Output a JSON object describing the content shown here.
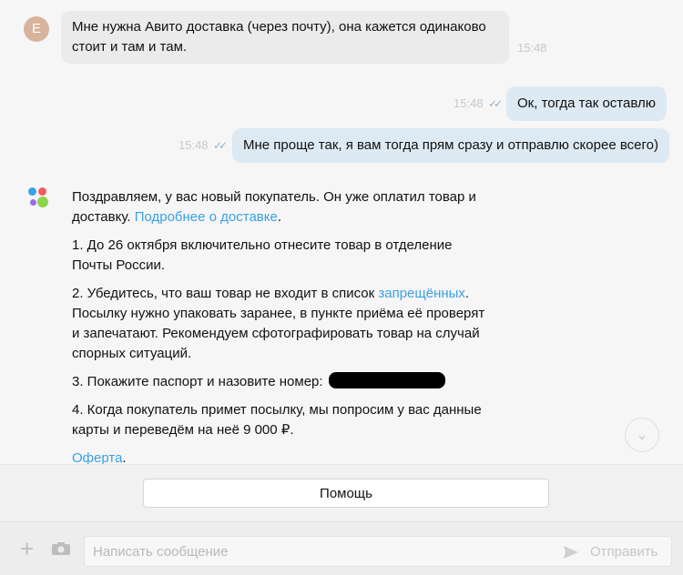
{
  "messages": {
    "incoming": {
      "avatar_letter": "Е",
      "text": "Мне нужна Авито доставка (через почту), она кажется одинаково стоит и там и там.",
      "time": "15:48"
    },
    "outgoing_1": {
      "text": "Ок, тогда так оставлю",
      "time": "15:48",
      "ticks": "✓✓"
    },
    "outgoing_2": {
      "text": "Мне проще так, я вам тогда прям сразу и отправлю скорее всего)",
      "time": "15:48",
      "ticks": "✓✓"
    }
  },
  "system": {
    "intro": "Поздравляем, у вас новый покупатель. Он уже оплатил товар и доставку.",
    "intro_link": "Подробнее о доставке",
    "intro_end": ".",
    "step1": "1. До 26 октября включительно отнесите товар в отделение Почты России.",
    "step2_start": "2. Убедитесь, что ваш товар не входит в список ",
    "step2_link": "запрещённых",
    "step2_end": ". Посылку нужно упаковать заранее, в пункте приёма её проверят и запечатают. Рекомендуем сфотографировать товар на случай спорных ситуаций.",
    "step3": "3. Покажите паспорт и назовите номер:",
    "step4": "4. Когда покупатель примет посылку, мы попросим у вас данные карты и переведём на неё 9 000 ₽.",
    "offer_link": "Оферта",
    "offer_end": "."
  },
  "help_button": "Помощь",
  "composer": {
    "placeholder": "Написать сообщение",
    "send_label": "Отправить"
  },
  "colors": {
    "incoming_bubble": "#ebebeb",
    "outgoing_bubble": "#dde9f3",
    "link": "#3aa0e6",
    "avatar": "#d9b49c"
  }
}
